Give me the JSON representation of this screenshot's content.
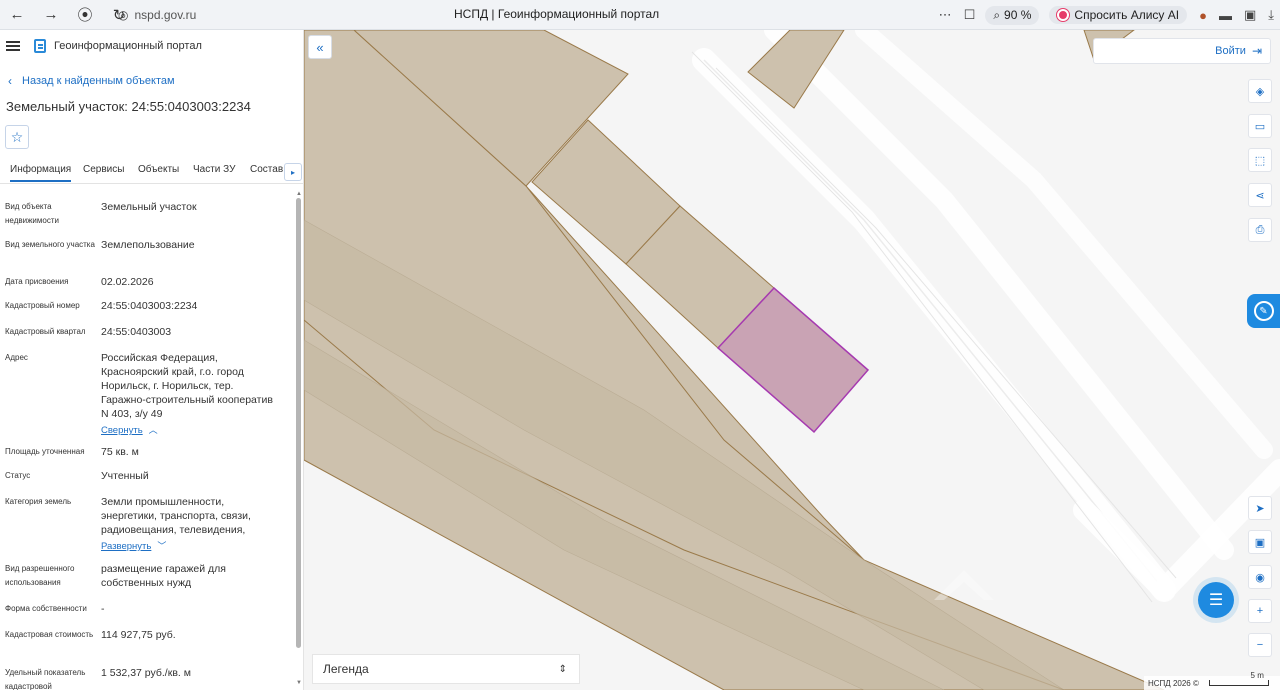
{
  "browser": {
    "url": "nspd.gov.ru",
    "title": "НСПД | Геоинформационный портал",
    "zoom": "90 %",
    "alice": "Спросить Алису AI"
  },
  "portal": {
    "name": "Геоинформационный портал",
    "back_link": "Назад к найденным объектам",
    "object_title": "Земельный участок: 24:55:0403003:2234"
  },
  "tabs": [
    "Информация",
    "Сервисы",
    "Объекты",
    "Части ЗУ",
    "Состав"
  ],
  "info": {
    "object_type_label": "Вид объекта недвижимости",
    "object_type_value": "Земельный участок",
    "land_kind_label": "Вид земельного участка",
    "land_kind_value": "Землепользование",
    "date_label": "Дата присвоения",
    "date_value": "02.02.2026",
    "cad_number_label": "Кадастровый номер",
    "cad_number_value": "24:55:0403003:2234",
    "cad_quarter_label": "Кадастровый квартал",
    "cad_quarter_value": "24:55:0403003",
    "address_label": "Адрес",
    "address_value": "Российская Федерация, Красноярский край, г.о. город Норильск, г. Норильск, тер. Гаражно-строительный кооператив N 403, з/у 49",
    "address_toggle": "Свернуть",
    "area_label": "Площадь уточненная",
    "area_value": "75 кв. м",
    "status_label": "Статус",
    "status_value": "Учтенный",
    "category_label": "Категория земель",
    "category_value": "Земли промышленности, энергетики, транспорта, связи, радиовещания, телевидения,",
    "category_toggle": "Развернуть",
    "permitted_use_label": "Вид разрешенного использования",
    "permitted_use_value": "размещение гаражей для собственных нужд",
    "ownership_label": "Форма собственности",
    "ownership_value": "-",
    "cad_value_label": "Кадастровая стоимость",
    "cad_value_value": "114 927,75 руб.",
    "specific_label": "Удельный показатель кадастровой",
    "specific_value": "1 532,37 руб./кв. м"
  },
  "map": {
    "login": "Войти",
    "legend": "Легенда",
    "copyright": "НСПД 2026 ©",
    "scale": "5 m",
    "colors": {
      "parcel_fill": "#cdc1ad",
      "parcel_stroke": "#9a7a4a",
      "selected_fill": "#c9a3b4",
      "selected_stroke": "#a63ab0",
      "accent": "#1e6fc4"
    }
  }
}
